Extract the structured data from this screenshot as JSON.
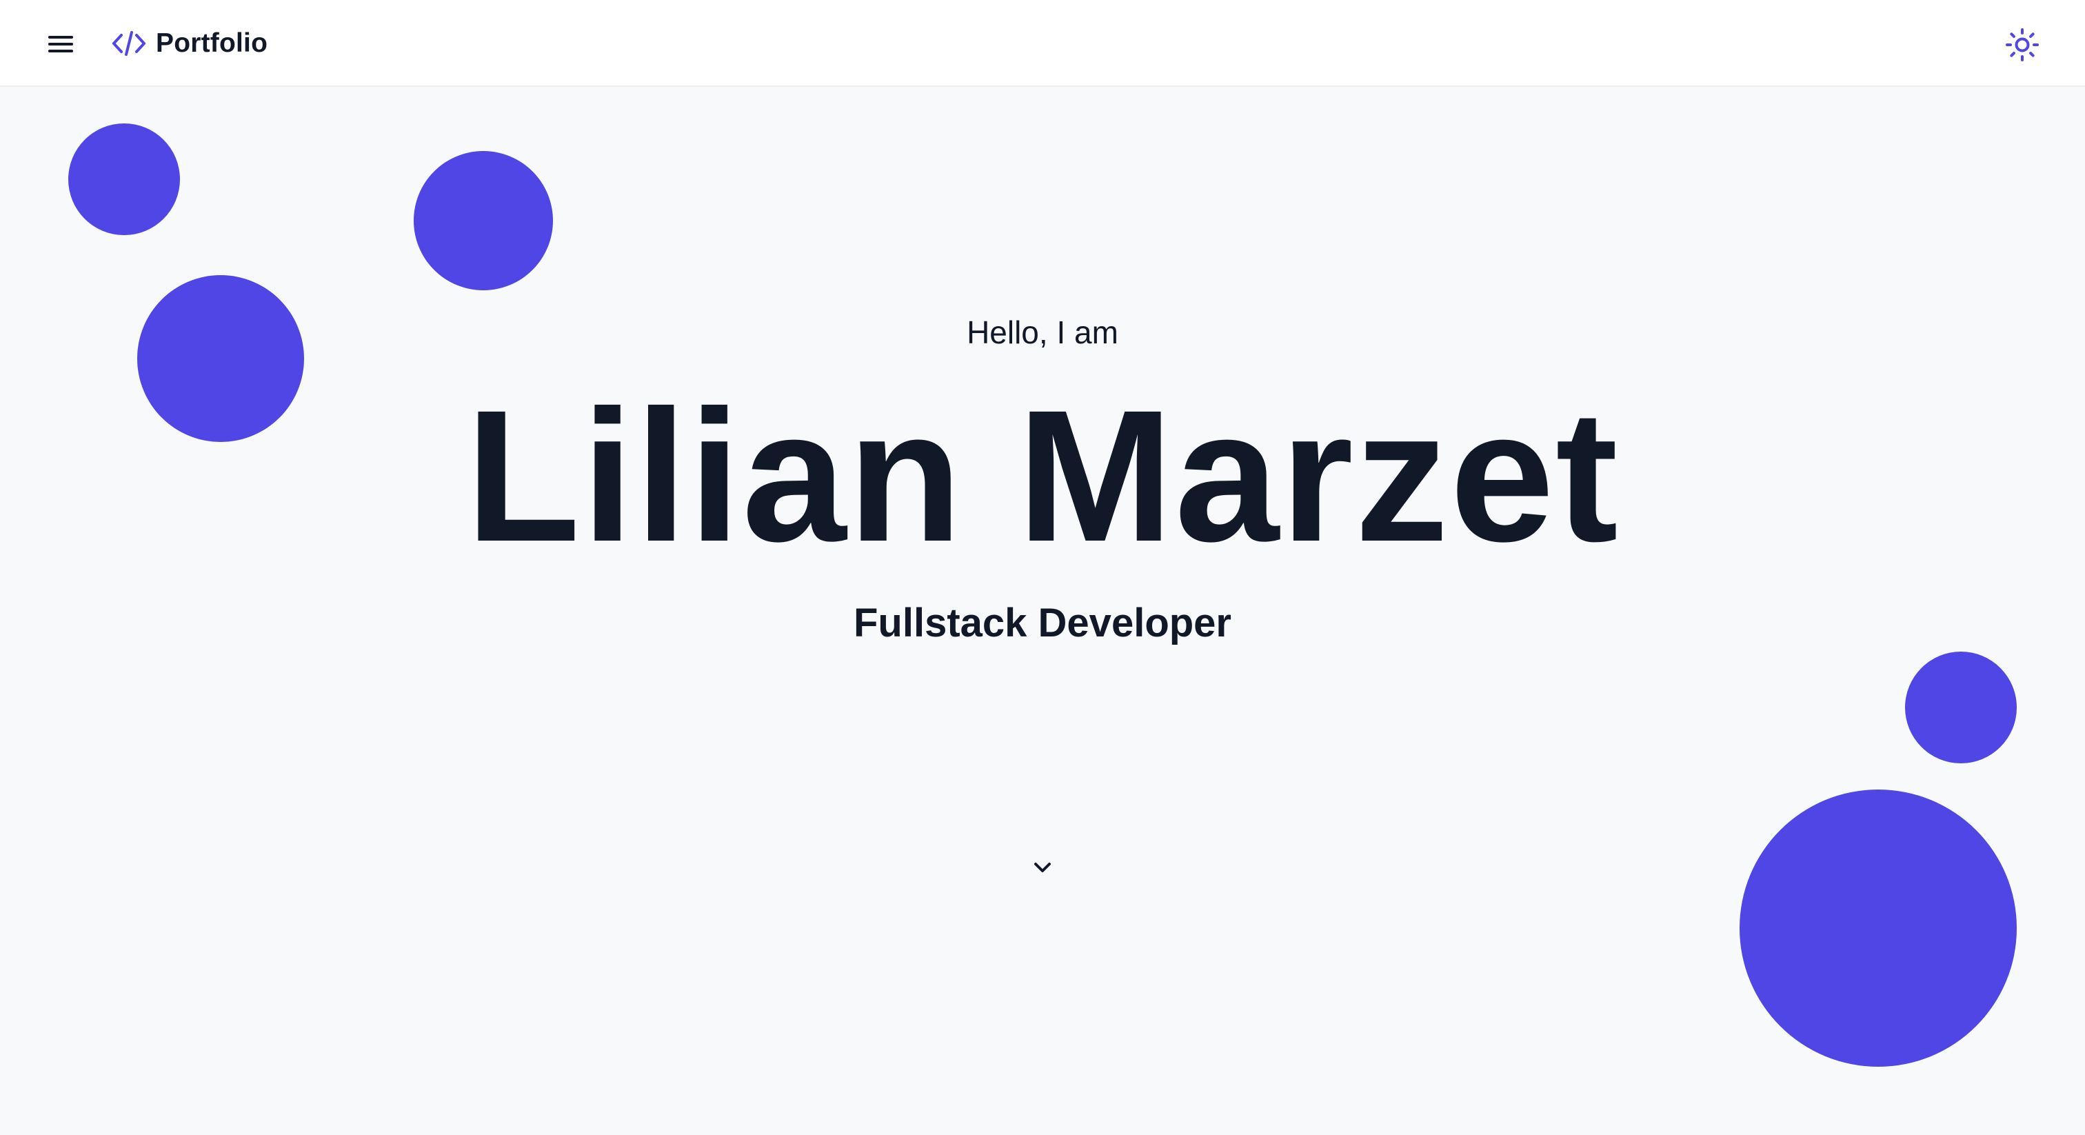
{
  "navbar": {
    "menu_icon": "hamburger-menu-icon",
    "brand_icon": "code-brackets-icon",
    "brand_label": "Portfolio",
    "theme_toggle_icon": "sun-icon"
  },
  "hero": {
    "greeting": "Hello, I am",
    "name": "Lilian Marzet",
    "role": "Fullstack Developer",
    "scroll_icon": "chevron-down-icon"
  },
  "colors": {
    "accent": "#4f46e5",
    "text": "#111827",
    "page_background": "#f8f9fb",
    "navbar_background": "#ffffff"
  }
}
